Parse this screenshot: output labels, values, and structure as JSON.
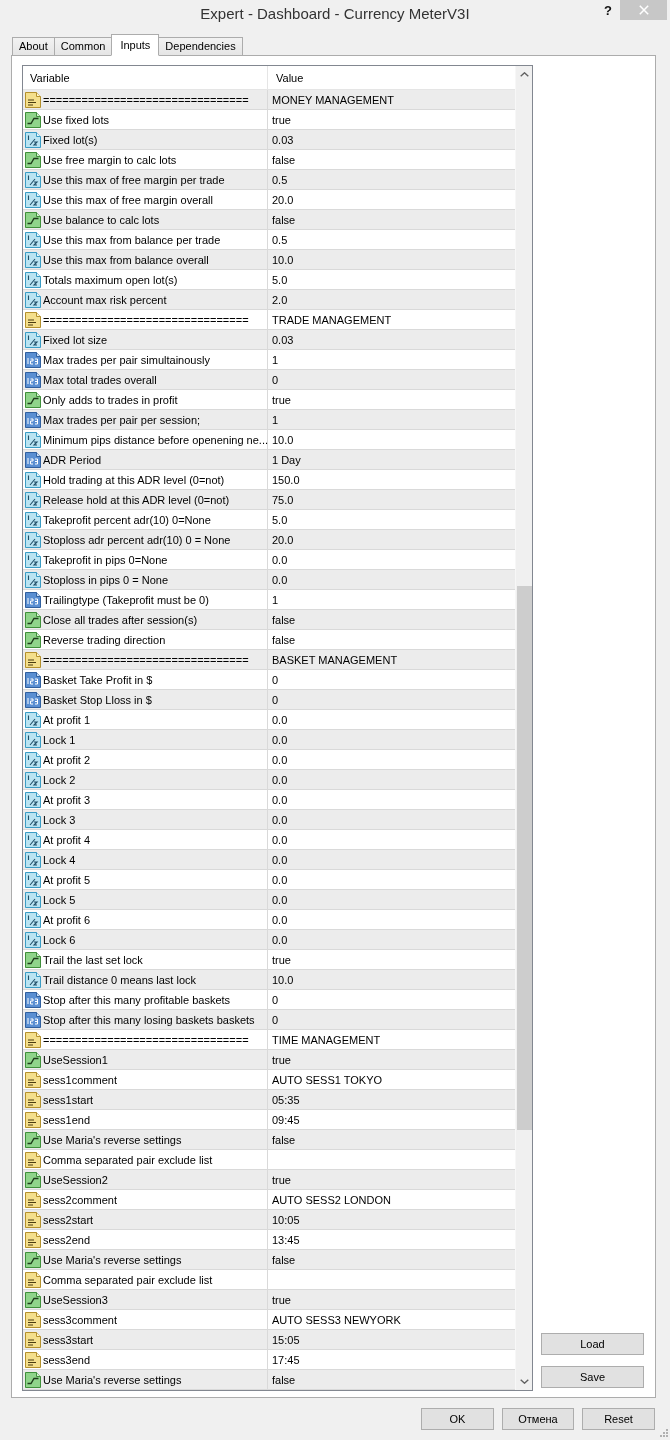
{
  "window": {
    "title": "Expert - Dashboard - Currency MeterV3I",
    "help_button": "?"
  },
  "tabs": [
    {
      "label": "About",
      "selected": false
    },
    {
      "label": "Common",
      "selected": false
    },
    {
      "label": "Inputs",
      "selected": true
    },
    {
      "label": "Dependencies",
      "selected": false
    }
  ],
  "table": {
    "columns": [
      "Variable",
      "Value"
    ],
    "rows": [
      {
        "kind": "string",
        "variable": "================================",
        "value": "MONEY MANAGEMENT"
      },
      {
        "kind": "bool",
        "variable": "Use fixed lots",
        "value": "true"
      },
      {
        "kind": "double",
        "variable": "Fixed lot(s)",
        "value": "0.03"
      },
      {
        "kind": "bool",
        "variable": "Use free margin to calc lots",
        "value": "false"
      },
      {
        "kind": "double",
        "variable": "Use this max of free margin per trade",
        "value": "0.5"
      },
      {
        "kind": "double",
        "variable": "Use this max of free margin overall",
        "value": "20.0"
      },
      {
        "kind": "bool",
        "variable": "Use balance to calc lots",
        "value": "false"
      },
      {
        "kind": "double",
        "variable": "Use this max from balance per trade",
        "value": "0.5"
      },
      {
        "kind": "double",
        "variable": "Use this max from balance overall",
        "value": "10.0"
      },
      {
        "kind": "double",
        "variable": "Totals maximum open lot(s)",
        "value": "5.0"
      },
      {
        "kind": "double",
        "variable": "Account max risk percent",
        "value": "2.0"
      },
      {
        "kind": "string",
        "variable": "================================",
        "value": "TRADE MANAGEMENT"
      },
      {
        "kind": "double",
        "variable": "Fixed lot size",
        "value": "0.03"
      },
      {
        "kind": "int",
        "variable": "Max trades per pair simultainously",
        "value": "1"
      },
      {
        "kind": "int",
        "variable": "Max total trades overall",
        "value": "0"
      },
      {
        "kind": "bool",
        "variable": "Only adds to trades in profit",
        "value": "true"
      },
      {
        "kind": "int",
        "variable": "Max trades per pair per session;",
        "value": "1"
      },
      {
        "kind": "double",
        "variable": "Minimum pips distance before openening ne...",
        "value": "10.0"
      },
      {
        "kind": "int",
        "variable": "ADR Period",
        "value": "1 Day"
      },
      {
        "kind": "double",
        "variable": "Hold trading at this ADR level (0=not)",
        "value": "150.0"
      },
      {
        "kind": "double",
        "variable": "Release hold at this ADR level (0=not)",
        "value": "75.0"
      },
      {
        "kind": "double",
        "variable": "Takeprofit percent adr(10) 0=None",
        "value": "5.0"
      },
      {
        "kind": "double",
        "variable": "Stoploss adr percent adr(10) 0 = None",
        "value": "20.0"
      },
      {
        "kind": "double",
        "variable": "Takeprofit in pips 0=None",
        "value": "0.0"
      },
      {
        "kind": "double",
        "variable": "Stoploss in pips 0 = None",
        "value": "0.0"
      },
      {
        "kind": "int",
        "variable": "Trailingtype (Takeprofit must be 0)",
        "value": "1"
      },
      {
        "kind": "bool",
        "variable": "Close all trades after session(s)",
        "value": "false"
      },
      {
        "kind": "bool",
        "variable": "Reverse trading direction",
        "value": "false"
      },
      {
        "kind": "string",
        "variable": "================================",
        "value": "BASKET MANAGEMENT"
      },
      {
        "kind": "int",
        "variable": "Basket Take Profit in $",
        "value": "0"
      },
      {
        "kind": "int",
        "variable": "Basket Stop Lloss in $",
        "value": "0"
      },
      {
        "kind": "double",
        "variable": "At profit 1",
        "value": "0.0"
      },
      {
        "kind": "double",
        "variable": "Lock 1",
        "value": "0.0"
      },
      {
        "kind": "double",
        "variable": "At profit 2",
        "value": "0.0"
      },
      {
        "kind": "double",
        "variable": "Lock 2",
        "value": "0.0"
      },
      {
        "kind": "double",
        "variable": "At profit 3",
        "value": "0.0"
      },
      {
        "kind": "double",
        "variable": "Lock 3",
        "value": "0.0"
      },
      {
        "kind": "double",
        "variable": "At profit 4",
        "value": "0.0"
      },
      {
        "kind": "double",
        "variable": "Lock 4",
        "value": "0.0"
      },
      {
        "kind": "double",
        "variable": "At profit 5",
        "value": "0.0"
      },
      {
        "kind": "double",
        "variable": "Lock 5",
        "value": "0.0"
      },
      {
        "kind": "double",
        "variable": "At profit 6",
        "value": "0.0"
      },
      {
        "kind": "double",
        "variable": "Lock 6",
        "value": "0.0"
      },
      {
        "kind": "bool",
        "variable": "Trail the last set lock",
        "value": "true"
      },
      {
        "kind": "double",
        "variable": "Trail distance 0 means last lock",
        "value": "10.0"
      },
      {
        "kind": "int",
        "variable": "Stop after this many profitable baskets",
        "value": "0"
      },
      {
        "kind": "int",
        "variable": "Stop after this many losing baskets baskets",
        "value": "0"
      },
      {
        "kind": "string",
        "variable": "================================",
        "value": "TIME MANAGEMENT"
      },
      {
        "kind": "bool",
        "variable": "UseSession1",
        "value": "true"
      },
      {
        "kind": "string",
        "variable": "sess1comment",
        "value": "AUTO SESS1 TOKYO"
      },
      {
        "kind": "string",
        "variable": "sess1start",
        "value": "05:35"
      },
      {
        "kind": "string",
        "variable": "sess1end",
        "value": "09:45"
      },
      {
        "kind": "bool",
        "variable": "Use Maria's reverse settings",
        "value": "false"
      },
      {
        "kind": "string",
        "variable": "Comma separated pair exclude list"
      },
      {
        "kind": "bool",
        "variable": "UseSession2",
        "value": "true"
      },
      {
        "kind": "string",
        "variable": "sess2comment",
        "value": "AUTO SESS2 LONDON"
      },
      {
        "kind": "string",
        "variable": "sess2start",
        "value": "10:05"
      },
      {
        "kind": "string",
        "variable": "sess2end",
        "value": "13:45"
      },
      {
        "kind": "bool",
        "variable": "Use Maria's reverse settings",
        "value": "false"
      },
      {
        "kind": "string",
        "variable": "Comma separated pair exclude list"
      },
      {
        "kind": "bool",
        "variable": "UseSession3",
        "value": "true"
      },
      {
        "kind": "string",
        "variable": "sess3comment",
        "value": "AUTO SESS3 NEWYORK"
      },
      {
        "kind": "string",
        "variable": "sess3start",
        "value": "15:05"
      },
      {
        "kind": "string",
        "variable": "sess3end",
        "value": "17:45"
      },
      {
        "kind": "bool",
        "variable": "Use Maria's reverse settings",
        "value": "false"
      }
    ]
  },
  "side_buttons": [
    "Load",
    "Save"
  ],
  "buttons": [
    "OK",
    "Отмена",
    "Reset"
  ]
}
